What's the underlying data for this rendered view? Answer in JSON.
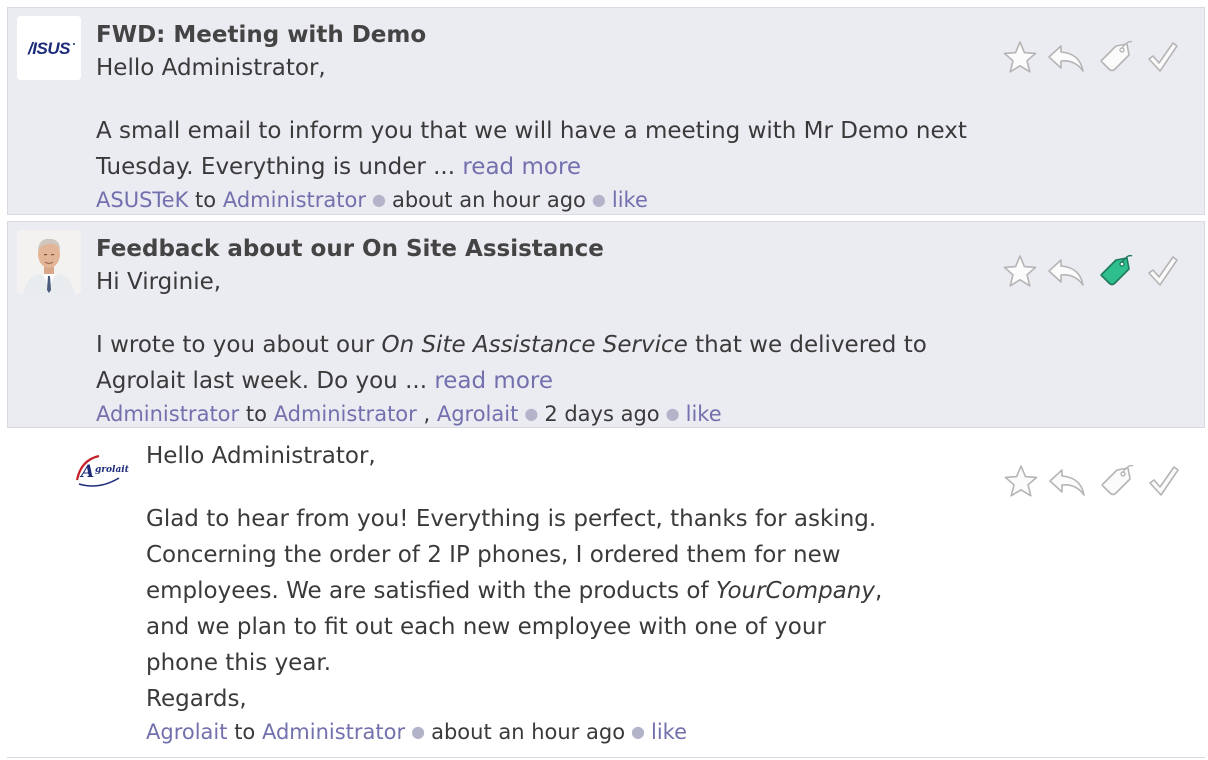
{
  "messages": [
    {
      "subject": "FWD: Meeting with Demo",
      "greeting": "Hello Administrator,",
      "body_text": "A small email to inform you that we will have a meeting with Mr Demo next Tuesday. Everything is under ...",
      "read_more": "read more",
      "author": "ASUSTeK",
      "to_word": "to",
      "recipient": "Administrator",
      "time": "about an hour ago",
      "like": "like",
      "avatar_logo": "ASUS",
      "tagged": false
    },
    {
      "subject": "Feedback about our On Site Assistance",
      "greeting": "Hi Virginie,",
      "body_before": "I wrote to you about our ",
      "body_italic": "On Site Assistance Service",
      "body_after": " that we delivered to Agrolait last week. Do you ...",
      "read_more": "read more",
      "author": "Administrator",
      "to_word": "to",
      "recipient": "Administrator",
      "sep": ",",
      "recipient2": "Agrolait",
      "time": "2 days ago",
      "like": "like",
      "tagged": true
    },
    {
      "greeting": "Hello Administrator,",
      "line1": "Glad to hear from you! Everything is perfect, thanks for asking.",
      "line2": "Concerning the order of 2 IP phones, I ordered them for new",
      "line3_before": "employees. We are satisfied with the products of ",
      "line3_italic": "YourCompany",
      "line3_after": ",",
      "line4": "and we plan to fit out each new employee with one of your",
      "line5": "phone this year.",
      "regards": "Regards,",
      "author": "Agrolait",
      "to_word": "to",
      "recipient": "Administrator",
      "time": "about an hour ago",
      "like": "like",
      "avatar_logo": "Agrolait",
      "tagged": false
    }
  ],
  "colors": {
    "link": "#7270ad",
    "shaded_bg": "#ebebf2",
    "tag_active": "#2fbf8f",
    "icon_stroke": "#b5b5b5",
    "asus_blue": "#1c2b7a",
    "agrolait_red": "#c4202b"
  },
  "icons": [
    "star-icon",
    "reply-icon",
    "tag-icon",
    "checkmark-icon"
  ]
}
